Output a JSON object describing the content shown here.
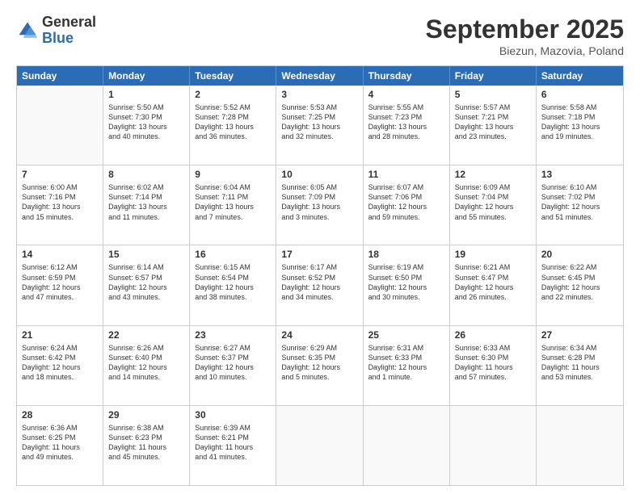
{
  "logo": {
    "general": "General",
    "blue": "Blue"
  },
  "header": {
    "month": "September 2025",
    "location": "Biezun, Mazovia, Poland"
  },
  "days": [
    "Sunday",
    "Monday",
    "Tuesday",
    "Wednesday",
    "Thursday",
    "Friday",
    "Saturday"
  ],
  "weeks": [
    [
      {
        "day": "",
        "empty": true,
        "lines": []
      },
      {
        "day": "1",
        "lines": [
          "Sunrise: 5:50 AM",
          "Sunset: 7:30 PM",
          "Daylight: 13 hours",
          "and 40 minutes."
        ]
      },
      {
        "day": "2",
        "lines": [
          "Sunrise: 5:52 AM",
          "Sunset: 7:28 PM",
          "Daylight: 13 hours",
          "and 36 minutes."
        ]
      },
      {
        "day": "3",
        "lines": [
          "Sunrise: 5:53 AM",
          "Sunset: 7:25 PM",
          "Daylight: 13 hours",
          "and 32 minutes."
        ]
      },
      {
        "day": "4",
        "lines": [
          "Sunrise: 5:55 AM",
          "Sunset: 7:23 PM",
          "Daylight: 13 hours",
          "and 28 minutes."
        ]
      },
      {
        "day": "5",
        "lines": [
          "Sunrise: 5:57 AM",
          "Sunset: 7:21 PM",
          "Daylight: 13 hours",
          "and 23 minutes."
        ]
      },
      {
        "day": "6",
        "lines": [
          "Sunrise: 5:58 AM",
          "Sunset: 7:18 PM",
          "Daylight: 13 hours",
          "and 19 minutes."
        ]
      }
    ],
    [
      {
        "day": "7",
        "lines": [
          "Sunrise: 6:00 AM",
          "Sunset: 7:16 PM",
          "Daylight: 13 hours",
          "and 15 minutes."
        ]
      },
      {
        "day": "8",
        "lines": [
          "Sunrise: 6:02 AM",
          "Sunset: 7:14 PM",
          "Daylight: 13 hours",
          "and 11 minutes."
        ]
      },
      {
        "day": "9",
        "lines": [
          "Sunrise: 6:04 AM",
          "Sunset: 7:11 PM",
          "Daylight: 13 hours",
          "and 7 minutes."
        ]
      },
      {
        "day": "10",
        "lines": [
          "Sunrise: 6:05 AM",
          "Sunset: 7:09 PM",
          "Daylight: 13 hours",
          "and 3 minutes."
        ]
      },
      {
        "day": "11",
        "lines": [
          "Sunrise: 6:07 AM",
          "Sunset: 7:06 PM",
          "Daylight: 12 hours",
          "and 59 minutes."
        ]
      },
      {
        "day": "12",
        "lines": [
          "Sunrise: 6:09 AM",
          "Sunset: 7:04 PM",
          "Daylight: 12 hours",
          "and 55 minutes."
        ]
      },
      {
        "day": "13",
        "lines": [
          "Sunrise: 6:10 AM",
          "Sunset: 7:02 PM",
          "Daylight: 12 hours",
          "and 51 minutes."
        ]
      }
    ],
    [
      {
        "day": "14",
        "lines": [
          "Sunrise: 6:12 AM",
          "Sunset: 6:59 PM",
          "Daylight: 12 hours",
          "and 47 minutes."
        ]
      },
      {
        "day": "15",
        "lines": [
          "Sunrise: 6:14 AM",
          "Sunset: 6:57 PM",
          "Daylight: 12 hours",
          "and 43 minutes."
        ]
      },
      {
        "day": "16",
        "lines": [
          "Sunrise: 6:15 AM",
          "Sunset: 6:54 PM",
          "Daylight: 12 hours",
          "and 38 minutes."
        ]
      },
      {
        "day": "17",
        "lines": [
          "Sunrise: 6:17 AM",
          "Sunset: 6:52 PM",
          "Daylight: 12 hours",
          "and 34 minutes."
        ]
      },
      {
        "day": "18",
        "lines": [
          "Sunrise: 6:19 AM",
          "Sunset: 6:50 PM",
          "Daylight: 12 hours",
          "and 30 minutes."
        ]
      },
      {
        "day": "19",
        "lines": [
          "Sunrise: 6:21 AM",
          "Sunset: 6:47 PM",
          "Daylight: 12 hours",
          "and 26 minutes."
        ]
      },
      {
        "day": "20",
        "lines": [
          "Sunrise: 6:22 AM",
          "Sunset: 6:45 PM",
          "Daylight: 12 hours",
          "and 22 minutes."
        ]
      }
    ],
    [
      {
        "day": "21",
        "lines": [
          "Sunrise: 6:24 AM",
          "Sunset: 6:42 PM",
          "Daylight: 12 hours",
          "and 18 minutes."
        ]
      },
      {
        "day": "22",
        "lines": [
          "Sunrise: 6:26 AM",
          "Sunset: 6:40 PM",
          "Daylight: 12 hours",
          "and 14 minutes."
        ]
      },
      {
        "day": "23",
        "lines": [
          "Sunrise: 6:27 AM",
          "Sunset: 6:37 PM",
          "Daylight: 12 hours",
          "and 10 minutes."
        ]
      },
      {
        "day": "24",
        "lines": [
          "Sunrise: 6:29 AM",
          "Sunset: 6:35 PM",
          "Daylight: 12 hours",
          "and 5 minutes."
        ]
      },
      {
        "day": "25",
        "lines": [
          "Sunrise: 6:31 AM",
          "Sunset: 6:33 PM",
          "Daylight: 12 hours",
          "and 1 minute."
        ]
      },
      {
        "day": "26",
        "lines": [
          "Sunrise: 6:33 AM",
          "Sunset: 6:30 PM",
          "Daylight: 11 hours",
          "and 57 minutes."
        ]
      },
      {
        "day": "27",
        "lines": [
          "Sunrise: 6:34 AM",
          "Sunset: 6:28 PM",
          "Daylight: 11 hours",
          "and 53 minutes."
        ]
      }
    ],
    [
      {
        "day": "28",
        "lines": [
          "Sunrise: 6:36 AM",
          "Sunset: 6:25 PM",
          "Daylight: 11 hours",
          "and 49 minutes."
        ]
      },
      {
        "day": "29",
        "lines": [
          "Sunrise: 6:38 AM",
          "Sunset: 6:23 PM",
          "Daylight: 11 hours",
          "and 45 minutes."
        ]
      },
      {
        "day": "30",
        "lines": [
          "Sunrise: 6:39 AM",
          "Sunset: 6:21 PM",
          "Daylight: 11 hours",
          "and 41 minutes."
        ]
      },
      {
        "day": "",
        "empty": true,
        "lines": []
      },
      {
        "day": "",
        "empty": true,
        "lines": []
      },
      {
        "day": "",
        "empty": true,
        "lines": []
      },
      {
        "day": "",
        "empty": true,
        "lines": []
      }
    ]
  ]
}
